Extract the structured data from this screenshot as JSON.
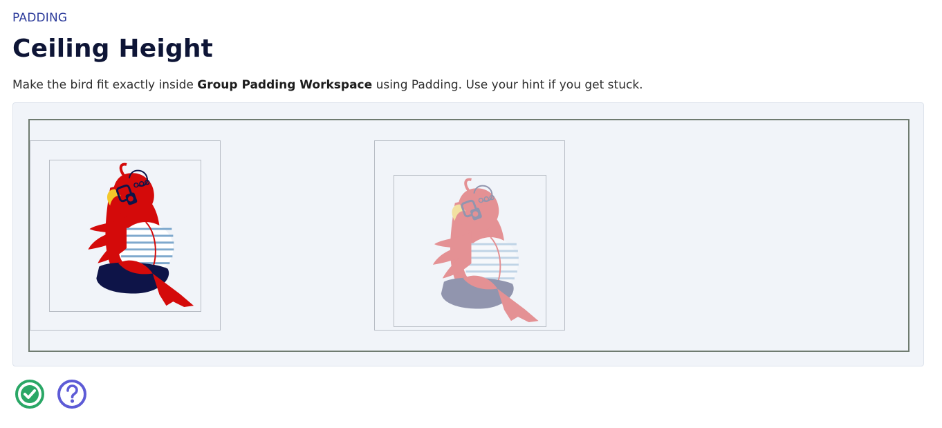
{
  "header": {
    "eyebrow": "PADDING",
    "title": "Ceiling Height"
  },
  "instructions": {
    "prefix": "Make the bird fit exactly inside ",
    "emphasis": "Group Padding Workspace",
    "suffix": " using Padding. Use your hint if you get stuck."
  },
  "workspace": {
    "name": "Group Padding Workspace"
  },
  "actions": {
    "check_icon": "check-circle-icon",
    "hint_icon": "question-circle-icon"
  },
  "colors": {
    "accent_blue": "#2b3a9a",
    "title_navy": "#0e1536",
    "check_green": "#2aa766",
    "hint_purple": "#5d5bd6",
    "bird_red": "#d40a0a",
    "bird_navy": "#0e1448"
  }
}
